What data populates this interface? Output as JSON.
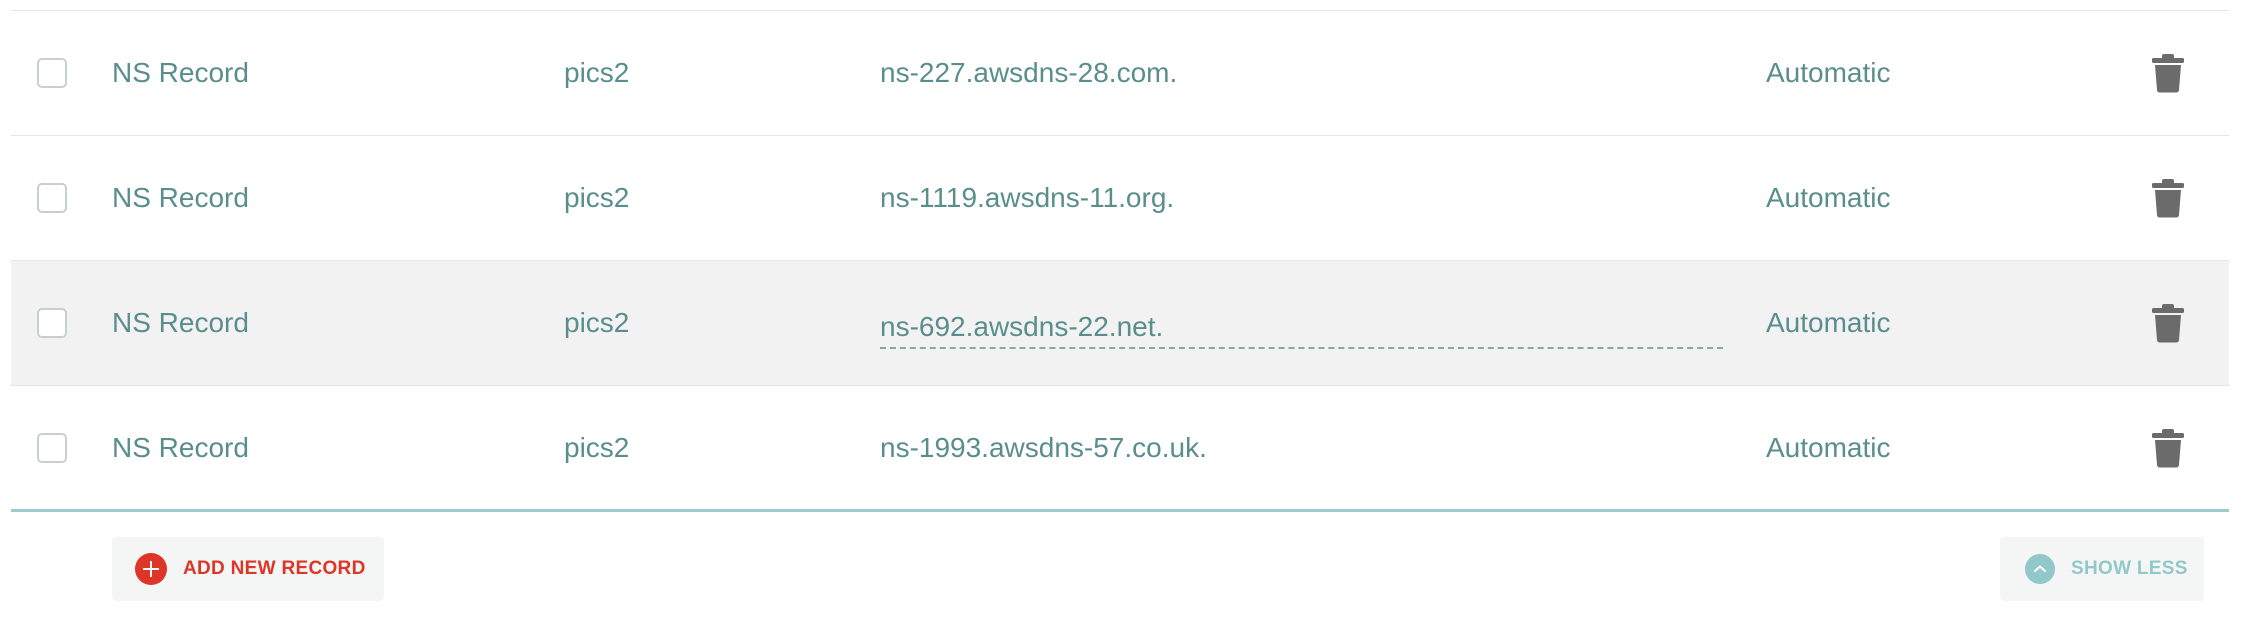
{
  "records": [
    {
      "type": "NS Record",
      "name": "pics2",
      "value": "ns-227.awsdns-28.com.",
      "ttl": "Automatic"
    },
    {
      "type": "NS Record",
      "name": "pics2",
      "value": "ns-1119.awsdns-11.org.",
      "ttl": "Automatic"
    },
    {
      "type": "NS Record",
      "name": "pics2",
      "value": "ns-692.awsdns-22.net.",
      "ttl": "Automatic"
    },
    {
      "type": "NS Record",
      "name": "pics2",
      "value": "ns-1993.awsdns-57.co.uk.",
      "ttl": "Automatic"
    }
  ],
  "icons": {
    "delete": "trash-icon",
    "add": "plus-circle-icon",
    "collapse": "chevron-up-circle-icon"
  },
  "footer": {
    "add_label": "ADD NEW RECORD",
    "show_less_label": "SHOW LESS"
  },
  "colors": {
    "text": "#5a8e8d",
    "accent_red": "#dd3526",
    "accent_teal": "#92c8c9",
    "trash": "#6b6b6b",
    "hover_row": "#f2f2f2"
  }
}
